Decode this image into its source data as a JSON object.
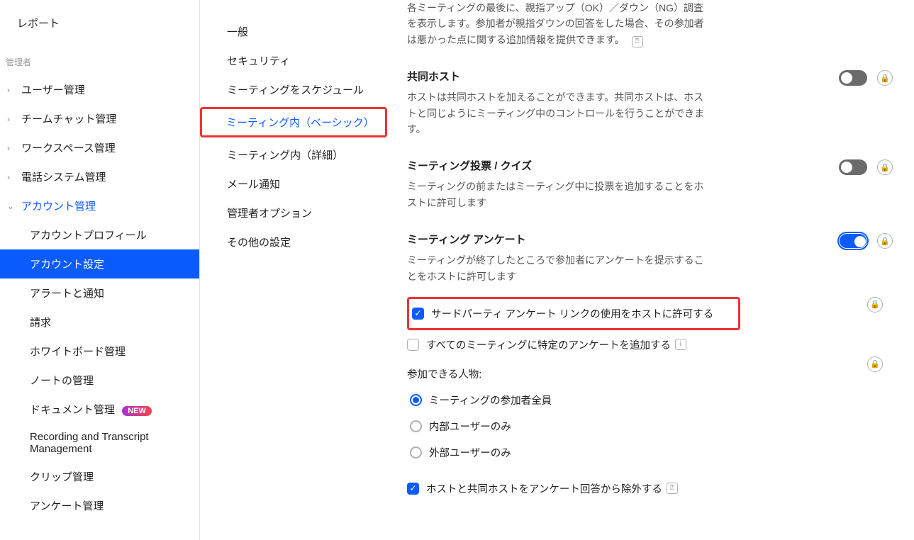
{
  "sidebar": {
    "report": "レポート",
    "admin_label": "管理者",
    "groups": [
      {
        "label": "ユーザー管理",
        "open": false
      },
      {
        "label": "チームチャット管理",
        "open": false
      },
      {
        "label": "ワークスペース管理",
        "open": false
      },
      {
        "label": "電話システム管理",
        "open": false
      },
      {
        "label": "アカウント管理",
        "open": true
      }
    ],
    "account_items": [
      {
        "label": "アカウントプロフィール"
      },
      {
        "label": "アカウント設定",
        "active": true
      },
      {
        "label": "アラートと通知"
      },
      {
        "label": "請求"
      },
      {
        "label": "ホワイトボード管理"
      },
      {
        "label": "ノートの管理"
      },
      {
        "label": "ドキュメント管理",
        "badge": "NEW"
      },
      {
        "label": "Recording and Transcript Management"
      },
      {
        "label": "クリップ管理"
      },
      {
        "label": "アンケート管理"
      }
    ]
  },
  "midnav": [
    {
      "label": "一般"
    },
    {
      "label": "セキュリティ"
    },
    {
      "label": "ミーティングをスケジュール"
    },
    {
      "label": "ミーティング内（ベーシック）",
      "selected": true
    },
    {
      "label": "ミーティング内（詳細）"
    },
    {
      "label": "メール通知"
    },
    {
      "label": "管理者オプション"
    },
    {
      "label": "その他の設定"
    }
  ],
  "settings": {
    "feedback_desc": "各ミーティングの最後に、親指アップ（OK）／ダウン（NG）調査を表示します。参加者が親指ダウンの回答をした場合、その参加者は悪かった点に関する追加情報を提供できます。",
    "cohost": {
      "title": "共同ホスト",
      "desc": "ホストは共同ホストを加えることができます。共同ホストは、ホストと同じようにミーティング中のコントロールを行うことができます。"
    },
    "poll": {
      "title": "ミーティング投票 / クイズ",
      "desc": "ミーティングの前またはミーティング中に投票を追加することをホストに許可します"
    },
    "survey": {
      "title": "ミーティング アンケート",
      "desc": "ミーティングが終了したところで参加者にアンケートを提示することをホストに許可します",
      "opt_thirdparty": "サードパーティ アンケート リンクの使用をホストに許可する",
      "opt_all_meetings": "すべてのミーティングに特定のアンケートを追加する",
      "who_label": "参加できる人物:",
      "who_all": "ミーティングの参加者全員",
      "who_internal": "内部ユーザーのみ",
      "who_external": "外部ユーザーのみ",
      "exclude_hosts": "ホストと共同ホストをアンケート回答から除外する"
    }
  }
}
